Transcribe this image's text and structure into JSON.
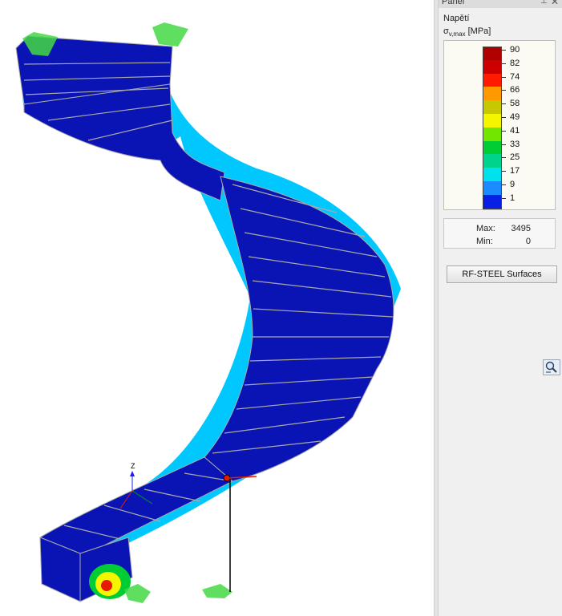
{
  "panel": {
    "title": "Panel",
    "pin_glyph": "⊥",
    "close_glyph": "✕",
    "result_type": "Napětí",
    "quantity_symbol": "σ",
    "quantity_subscript": "v,max",
    "quantity_unit": "[MPa]",
    "legend": [
      {
        "value": "90",
        "color": "#b00000"
      },
      {
        "value": "82",
        "color": "#cc0000"
      },
      {
        "value": "74",
        "color": "#ff1a00"
      },
      {
        "value": "66",
        "color": "#ff9900"
      },
      {
        "value": "58",
        "color": "#c8c800"
      },
      {
        "value": "49",
        "color": "#f5f500"
      },
      {
        "value": "41",
        "color": "#73e600"
      },
      {
        "value": "33",
        "color": "#00cc33"
      },
      {
        "value": "25",
        "color": "#00d48c"
      },
      {
        "value": "17",
        "color": "#00e1ee"
      },
      {
        "value": "9",
        "color": "#1a8cff"
      },
      {
        "value": "1",
        "color": "#0a1fe6"
      }
    ],
    "legend_bottom_color": "#00008c",
    "max_label": "Max:",
    "max_value": "3495",
    "min_label": "Min:",
    "min_value": "0",
    "module_button_label": "RF-STEEL Surfaces",
    "zoom_tool_icon": "magnifier-icon"
  },
  "viewport": {
    "axis_label": "Z",
    "colors": {
      "steel_blue": "#0a14b4",
      "mesh_line": "#a9a9a9",
      "support_green": "#43d843",
      "cyan": "#00c8ff",
      "yellow": "#f5f500",
      "red": "#e61a00"
    }
  }
}
